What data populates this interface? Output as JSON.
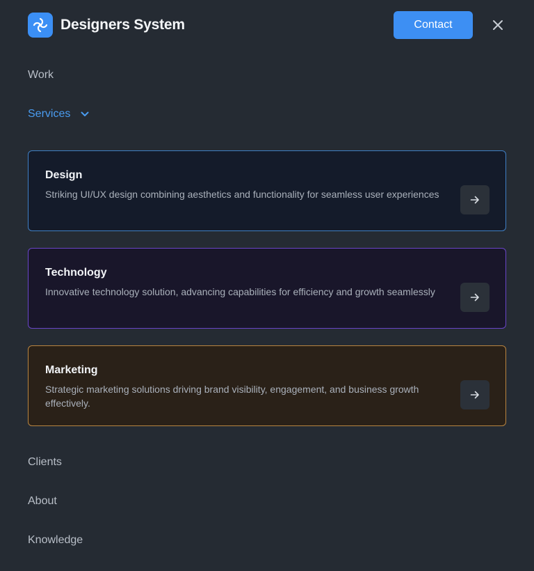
{
  "header": {
    "brand_name": "Designers System",
    "contact_label": "Contact",
    "logo_icon": "aperture-logo-icon",
    "close_icon": "close-icon",
    "accent_color": "#3d8ff3"
  },
  "nav": {
    "work": "Work",
    "services": "Services",
    "services_expanded": true,
    "clients": "Clients",
    "about": "About",
    "knowledge": "Knowledge"
  },
  "services": [
    {
      "title": "Design",
      "description": "Striking UI/UX design combining aesthetics and functionality for seamless user experiences",
      "icon": "arrow-right-icon",
      "border_color": "#3f7fc4",
      "bg_color": "#141b2a"
    },
    {
      "title": "Technology",
      "description": "Innovative technology solution, advancing capabilities for efficiency and growth seamlessly",
      "icon": "arrow-right-icon",
      "border_color": "#6a45c8",
      "bg_color": "#19162a"
    },
    {
      "title": "Marketing",
      "description": "Strategic marketing solutions driving brand visibility, engagement, and business growth effectively.",
      "icon": "arrow-right-icon",
      "border_color": "#b98540",
      "bg_color": "#2a2118"
    }
  ]
}
